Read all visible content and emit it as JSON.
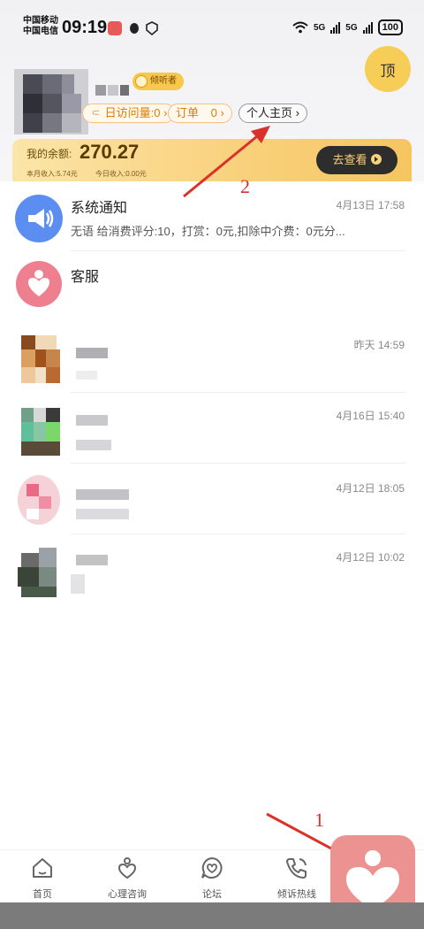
{
  "status_bar": {
    "carrier_1": "中国移动",
    "carrier_2": "中国电信",
    "time": "09:19",
    "network_1": "5G",
    "network_2": "5G",
    "battery": "100"
  },
  "header": {
    "top_button_label": "顶",
    "badge_label": "倾听者",
    "daily_visits_label": "日访问量:0",
    "orders_label": "订单",
    "orders_count": "0",
    "profile_label": "个人主页",
    "balance_label": "我的余额:",
    "balance_value": "270.27",
    "monthly_income": "本月收入:5.74元",
    "today_income": "今日收入:0.00元",
    "view_button_label": "去查看"
  },
  "messages": [
    {
      "title": "系统通知",
      "time": "4月13日 17:58",
      "preview": "无语 给消费评分:10，打赏：0元,扣除中介费：0元分..."
    },
    {
      "title": "客服",
      "time": "",
      "preview": ""
    },
    {
      "title": "",
      "time": "昨天 14:59",
      "preview": ""
    },
    {
      "title": "",
      "time": "4月16日 15:40",
      "preview": ""
    },
    {
      "title": "",
      "time": "4月12日 18:05",
      "preview": ""
    },
    {
      "title": "",
      "time": "4月12日 10:02",
      "preview": ""
    }
  ],
  "bottom_nav": {
    "items": [
      {
        "label": "首页",
        "icon": "home-icon"
      },
      {
        "label": "心理咨询",
        "icon": "consult-icon"
      },
      {
        "label": "论坛",
        "icon": "forum-icon"
      },
      {
        "label": "倾诉热线",
        "icon": "phone-icon"
      }
    ]
  },
  "annotations": {
    "marker_1": "1",
    "marker_2": "2"
  },
  "colors": {
    "accent_yellow": "#f6cd57",
    "balance_dark_button": "#2d2d2d",
    "float_heart": "#ec9392",
    "annotation_red": "#d8322a",
    "system_icon_blue": "#5b8ef0",
    "service_icon_pink": "#ee7f8f"
  }
}
